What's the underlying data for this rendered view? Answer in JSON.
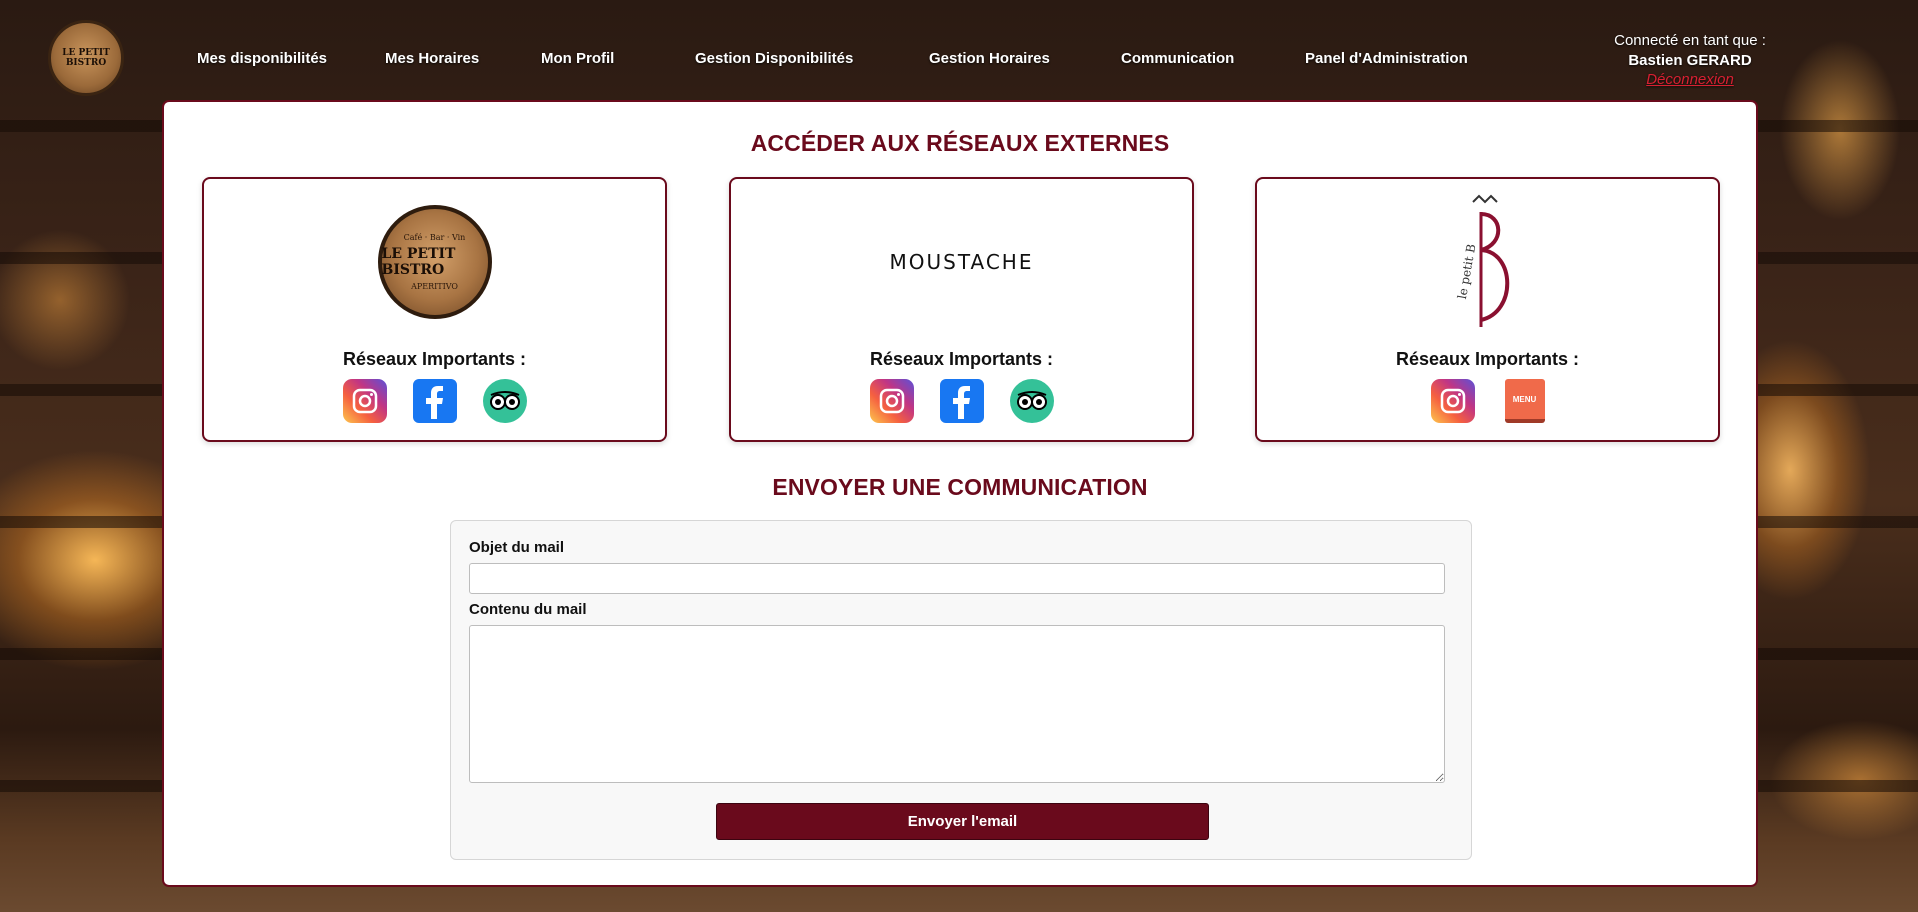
{
  "header": {
    "logo_text": "LE PETIT BISTRO",
    "nav": [
      {
        "label": "Mes disponibilités"
      },
      {
        "label": "Mes Horaires"
      },
      {
        "label": "Mon Profil"
      },
      {
        "label": "Gestion Disponibilités"
      },
      {
        "label": "Gestion Horaires"
      },
      {
        "label": "Communication"
      },
      {
        "label": "Panel d'Administration"
      }
    ],
    "user": {
      "connected_label": "Connecté en tant que :",
      "name": "Bastien GERARD",
      "logout": "Déconnexion"
    }
  },
  "networks": {
    "title": "ACCÉDER AUX RÉSEAUX EXTERNES",
    "cards": [
      {
        "logo": {
          "line1": "Café · Bar · Vin",
          "line2": "LE PETIT BISTRO",
          "line3": "APERITIVO"
        },
        "subtitle": "Réseaux Importants :",
        "icons": [
          "instagram-icon",
          "facebook-icon",
          "tripadvisor-icon"
        ]
      },
      {
        "logo": {
          "text": "MOUSTACHE"
        },
        "subtitle": "Réseaux Importants :",
        "icons": [
          "instagram-icon",
          "facebook-icon",
          "tripadvisor-icon"
        ]
      },
      {
        "logo": {
          "text": "le petit B"
        },
        "subtitle": "Réseaux Importants :",
        "icons": [
          "instagram-icon",
          "menu-icon"
        ],
        "menu_label": "MENU"
      }
    ]
  },
  "communication": {
    "title": "ENVOYER UNE COMMUNICATION",
    "subject_label": "Objet du mail",
    "subject_value": "",
    "content_label": "Contenu du mail",
    "content_value": "",
    "send_button": "Envoyer l'email"
  },
  "colors": {
    "accent": "#6a0a1c",
    "logout": "#d72032"
  }
}
